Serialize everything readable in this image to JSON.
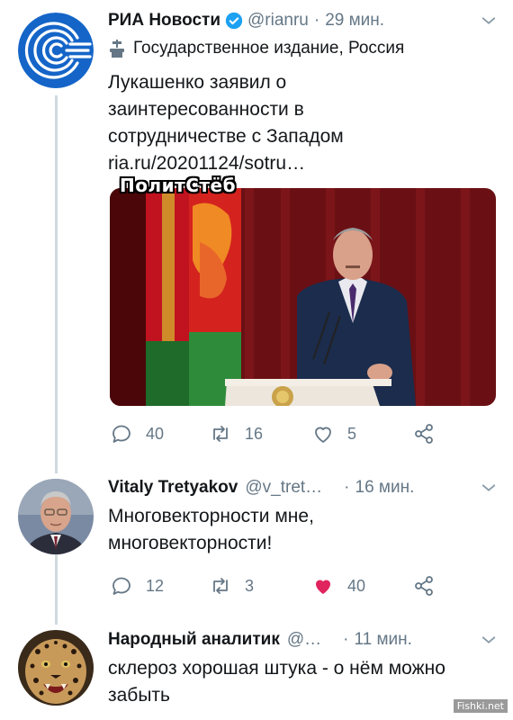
{
  "tweets": [
    {
      "name": "РИА Новости",
      "handle": "@rianru",
      "separator": "·",
      "time": "29 мин.",
      "label": "Государственное издание, Россия",
      "text": "Лукашенко заявил о заинтересованности в сотрудничестве с Западом",
      "link": "ria.ru/20201124/sotru…",
      "media_overlay": "ПолитСтёб",
      "actions": {
        "replies": "40",
        "retweets": "16",
        "likes": "5"
      }
    },
    {
      "name": "Vitaly Tretyakov",
      "handle": "@v_tret…",
      "separator": "·",
      "time": "16 мин.",
      "text": "Многовекторности мне, многовекторности!",
      "actions": {
        "replies": "12",
        "retweets": "3",
        "likes": "40"
      }
    },
    {
      "name": "Народный аналитик",
      "handle": "@…",
      "separator": "·",
      "time": "11 мин.",
      "text": "склероз хорошая штука - о нём можно забыть"
    }
  ],
  "watermark": "Fishki.net",
  "icons": {
    "verified": "verified-badge-icon",
    "state_media": "podium-icon",
    "reply": "reply-icon",
    "retweet": "retweet-icon",
    "like": "heart-icon",
    "share": "share-icon",
    "caret": "chevron-down-icon"
  },
  "colors": {
    "accent": "#1da1f2",
    "like_active": "#e0245e",
    "muted": "#657786"
  }
}
